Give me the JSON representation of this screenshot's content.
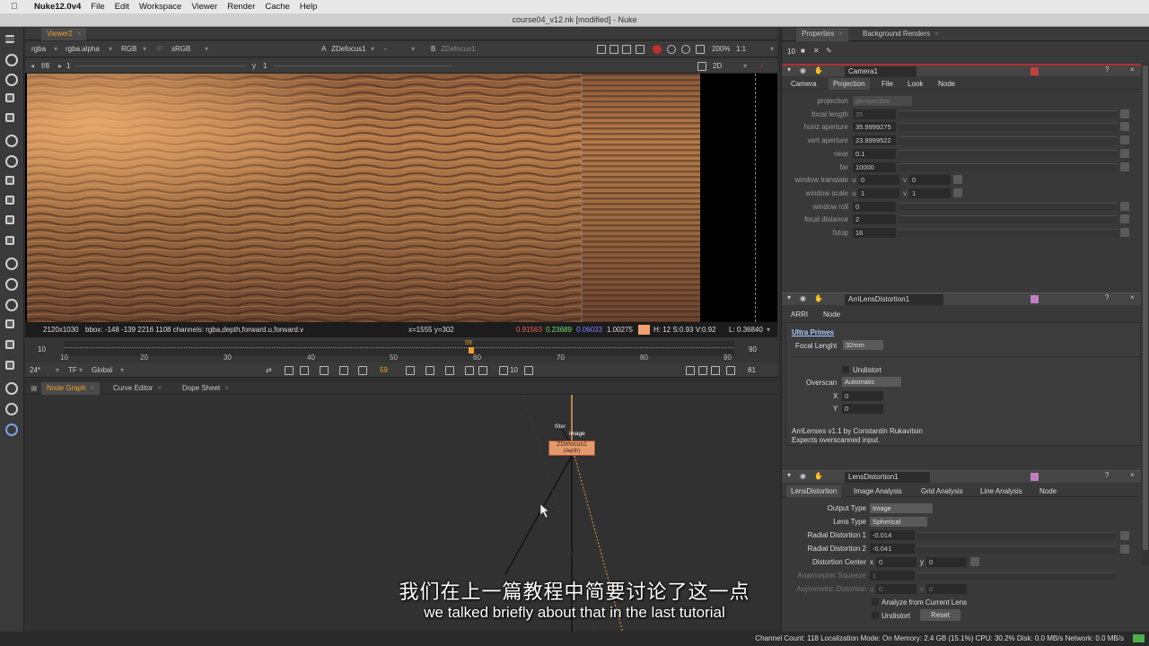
{
  "menubar": {
    "app": "Nuke12.0v4",
    "items": [
      "File",
      "Edit",
      "Workspace",
      "Viewer",
      "Render",
      "Cache",
      "Help"
    ]
  },
  "window_title": "course04_v12.nk [modified] - Nuke",
  "viewer": {
    "tab": "Viewer2",
    "channels": "rgba",
    "alpha": "rgba.alpha",
    "color": "RGB",
    "ip": "IP",
    "lut": "sRGB",
    "input_a": "ZDefocus1",
    "dash": "-",
    "b_label": "B",
    "input_b": "ZDefocus1",
    "zoom": "200%",
    "ratio": "1:1",
    "fstop": "f/8",
    "gain": "1",
    "y_label": "y",
    "gamma": "1",
    "mode": "2D",
    "info": {
      "res": "2120x1030",
      "bbox": "bbox: -148 -139 2216 1108 channels: rgba,depth,forward.u,forward.v",
      "coords": "x=1555 y=302",
      "r": "0.91563",
      "g": "0.23689",
      "b": "0.06033",
      "a": "1.00275",
      "hsv": "H: 12 S:0.93 V:0.92",
      "l": "L: 0.36840"
    },
    "swatch": "#f4a070"
  },
  "timeline": {
    "ticks": [
      "10",
      "20",
      "30",
      "40",
      "50",
      "60",
      "70",
      "80",
      "90"
    ],
    "start": "10",
    "end": "90",
    "current_marker": "59",
    "fps": "24*",
    "tf": "TF",
    "scope": "Global",
    "frame": "59",
    "step": "10",
    "end_frame": "81"
  },
  "panels": {
    "tabs": [
      "Node Graph",
      "Curve Editor",
      "Dope Sheet"
    ]
  },
  "nodegraph": {
    "node_label": "ZDefocus1",
    "node_sub": "(depth)",
    "filter": "filter",
    "image": "image"
  },
  "properties": {
    "tabs": [
      "Properties",
      "Background Renders"
    ],
    "count": "10",
    "camera": {
      "name": "Camera1",
      "tabs": [
        "Camera",
        "Projection",
        "File",
        "Look",
        "Node"
      ],
      "active_tab": "Projection",
      "knobs": [
        {
          "label": "projection",
          "value": "perspective",
          "dim": true
        },
        {
          "label": "focal length",
          "value": "35",
          "dim": true
        },
        {
          "label": "horiz aperture",
          "value": "35.9999275"
        },
        {
          "label": "vert aperture",
          "value": "23.9999522"
        },
        {
          "label": "near",
          "value": "0.1"
        },
        {
          "label": "far",
          "value": "10000"
        },
        {
          "label": "window translate",
          "u": "0",
          "v": "0"
        },
        {
          "label": "window scale",
          "u": "1",
          "v": "1"
        },
        {
          "label": "window roll",
          "value": "0"
        },
        {
          "label": "focal distance",
          "value": "2"
        },
        {
          "label": "fstop",
          "value": "16"
        }
      ],
      "u": "u",
      "v": "v"
    },
    "arri": {
      "name": "ArriLensDistortion1",
      "tabs": [
        "ARRI",
        "Node"
      ],
      "section": "Ultra Primes",
      "focal_label": "Focal Lenght",
      "focal_value": "32mm",
      "undistort": "Undistort",
      "overscan_label": "Overscan",
      "overscan_value": "Automatic",
      "x_label": "X",
      "x_value": "0",
      "y_label": "Y",
      "y_value": "0",
      "credit1": "ArriLenses v1.1 by Constantin Rukavitsin",
      "credit2": "Expects overscanned input."
    },
    "lens": {
      "name": "LensDistortion1",
      "tabs": [
        "LensDistortion",
        "Image Analysis",
        "Grid Analysis",
        "Line Analysis",
        "Node"
      ],
      "output_type_label": "Output Type",
      "output_type": "Image",
      "lens_type_label": "Lens Type",
      "lens_type": "Spherical",
      "rd1_label": "Radial Distortion 1",
      "rd1": "-0.014",
      "rd2_label": "Radial Distortion 2",
      "rd2": "-0.041",
      "dc_label": "Distortion Center",
      "dc_x": "0",
      "dc_y": "0",
      "as_label": "Anamorphic Squeeze",
      "as": "1",
      "ad_label": "Asymmetric Distortion",
      "ad_u": "0",
      "ad_v": "0",
      "analyze": "Analyze from Current Lens",
      "undistort": "Undistort",
      "reset": "Reset"
    }
  },
  "status": "Channel Count: 118  Localization Mode: On  Memory: 2.4 GB (15.1%)  CPU: 30.2%  Disk: 0.0 MB/s  Network: 0.0 MB/s",
  "subtitle_cn": "我们在上一篇教程中简要讨论了这一点",
  "subtitle_en": "we talked briefly about that in the last tutorial"
}
